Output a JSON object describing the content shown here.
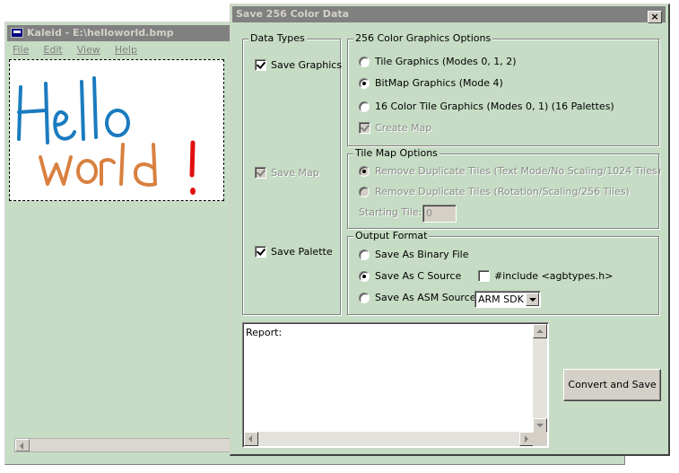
{
  "background_app": {
    "title": "Kaleid - E:\\helloworld.bmp",
    "menu": [
      "File",
      "Edit",
      "View",
      "Help"
    ],
    "canvas_text": {
      "line1": "Hello",
      "line2": "world",
      "line3": "!"
    },
    "colors": {
      "hello": "#1a7bbf",
      "world": "#d98040",
      "exclaim": "#e01010"
    }
  },
  "dialog": {
    "title": "Save 256 Color Data",
    "close_glyph": "×",
    "data_types": {
      "caption": "Data Types",
      "save_graphics": "Save Graphics",
      "save_map": "Save Map",
      "save_palette": "Save Palette"
    },
    "graphics_options": {
      "caption": "256 Color Graphics Options",
      "tile": "Tile Graphics (Modes 0, 1, 2)",
      "bitmap": "BitMap Graphics (Mode 4)",
      "tile16": "16 Color Tile Graphics (Modes 0, 1) (16 Palettes)",
      "create_map": "Create Map",
      "selected": "bitmap"
    },
    "tilemap_options": {
      "caption": "Tile Map Options",
      "remove_text": "Remove Duplicate Tiles (Text Mode/No Scaling/1024 Tiles)",
      "remove_rot": "Remove Duplicate Tiles (Rotation/Scaling/256 Tiles)",
      "starting_tile_label": "Starting Tile:",
      "starting_tile_value": "0"
    },
    "output_format": {
      "caption": "Output Format",
      "binary": "Save As Binary File",
      "c_source": "Save As C Source",
      "include": "#include <agbtypes.h>",
      "asm": "Save As ASM Source",
      "asm_combo": "ARM SDK",
      "selected": "c_source"
    },
    "report_label": "Report:",
    "convert_button": "Convert and Save"
  }
}
